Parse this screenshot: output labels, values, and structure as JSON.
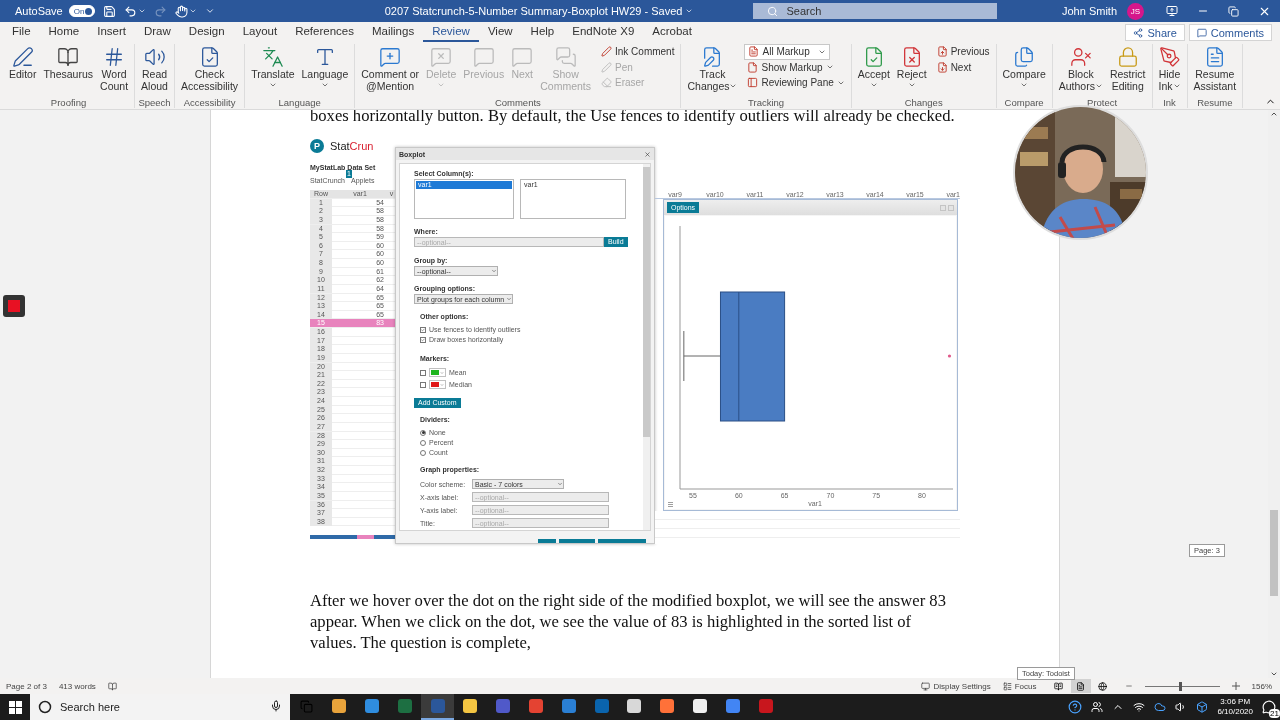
{
  "title_bar": {
    "autosave_label": "AutoSave",
    "autosave": {
      "label": "On",
      "on": true
    },
    "redo_disabled": true,
    "document_title": "0207 Statcrunch-5-Number Summary-Boxplot HW29  -  Saved",
    "search_placeholder": "Search",
    "user_name": "John Smith",
    "user_initials": "JS"
  },
  "ribbon_tabs": [
    {
      "label": "File",
      "selected": false
    },
    {
      "label": "Home",
      "selected": false
    },
    {
      "label": "Insert",
      "selected": false
    },
    {
      "label": "Draw",
      "selected": false
    },
    {
      "label": "Design",
      "selected": false
    },
    {
      "label": "Layout",
      "selected": false
    },
    {
      "label": "References",
      "selected": false
    },
    {
      "label": "Mailings",
      "selected": false
    },
    {
      "label": "Review",
      "selected": true
    },
    {
      "label": "View",
      "selected": false
    },
    {
      "label": "Help",
      "selected": false
    },
    {
      "label": "EndNote X9",
      "selected": false
    },
    {
      "label": "Acrobat",
      "selected": false
    }
  ],
  "share_button": "Share",
  "comments_button": "Comments",
  "ribbon_groups": [
    {
      "label": "Proofing",
      "buttons": [
        {
          "lines": [
            "Editor"
          ],
          "dropdown": false,
          "disabled": false
        },
        {
          "lines": [
            "Thesaurus"
          ],
          "dropdown": false,
          "disabled": false
        },
        {
          "lines": [
            "Word",
            "Count"
          ],
          "dropdown": false,
          "disabled": false
        }
      ]
    },
    {
      "label": "Speech",
      "buttons": [
        {
          "lines": [
            "Read",
            "Aloud"
          ],
          "dropdown": false,
          "disabled": false
        }
      ]
    },
    {
      "label": "Accessibility",
      "buttons": [
        {
          "lines": [
            "Check",
            "Accessibility"
          ],
          "dropdown": false,
          "disabled": false
        }
      ]
    },
    {
      "label": "Language",
      "buttons": [
        {
          "lines": [
            "Translate"
          ],
          "dropdown": true,
          "disabled": false
        },
        {
          "lines": [
            "Language"
          ],
          "dropdown": true,
          "disabled": false
        }
      ]
    },
    {
      "label": "Comments",
      "buttons": [
        {
          "lines": [
            "Comment or",
            "@Mention"
          ],
          "dropdown": false,
          "disabled": false
        },
        {
          "lines": [
            "Delete"
          ],
          "dropdown": true,
          "disabled": true
        },
        {
          "lines": [
            "Previous"
          ],
          "dropdown": false,
          "disabled": true
        },
        {
          "lines": [
            "Next"
          ],
          "dropdown": false,
          "disabled": true
        },
        {
          "lines": [
            "Show",
            "Comments"
          ],
          "dropdown": false,
          "disabled": true
        }
      ],
      "small_buttons": [
        {
          "kind": "button",
          "label": "Ink Comment",
          "dropdown": false,
          "disabled": false
        },
        {
          "kind": "button",
          "label": "Pen",
          "dropdown": false,
          "disabled": true
        },
        {
          "kind": "button",
          "label": "Eraser",
          "dropdown": false,
          "disabled": true
        }
      ]
    },
    {
      "label": "Tracking",
      "buttons": [
        {
          "lines": [
            "Track",
            "Changes"
          ],
          "dropdown": true,
          "disabled": false
        }
      ],
      "small_buttons": [
        {
          "kind": "select",
          "label": "All Markup",
          "dropdown": true,
          "disabled": false
        },
        {
          "kind": "button",
          "label": "Show Markup",
          "dropdown": true,
          "disabled": false
        },
        {
          "kind": "button",
          "label": "Reviewing Pane",
          "dropdown": true,
          "disabled": false
        }
      ]
    },
    {
      "label": "Changes",
      "buttons": [
        {
          "lines": [
            "Accept"
          ],
          "dropdown": true,
          "disabled": false
        },
        {
          "lines": [
            "Reject"
          ],
          "dropdown": true,
          "disabled": false
        }
      ],
      "small_buttons": [
        {
          "kind": "button",
          "label": "Previous",
          "dropdown": false,
          "disabled": false
        },
        {
          "kind": "button",
          "label": "Next",
          "dropdown": false,
          "disabled": false
        }
      ]
    },
    {
      "label": "Compare",
      "buttons": [
        {
          "lines": [
            "Compare"
          ],
          "dropdown": true,
          "disabled": false
        }
      ]
    },
    {
      "label": "Protect",
      "buttons": [
        {
          "lines": [
            "Block",
            "Authors"
          ],
          "dropdown": true,
          "disabled": false
        },
        {
          "lines": [
            "Restrict",
            "Editing"
          ],
          "dropdown": false,
          "disabled": false
        }
      ]
    },
    {
      "label": "Ink",
      "buttons": [
        {
          "lines": [
            "Hide",
            "Ink"
          ],
          "dropdown": true,
          "disabled": false
        }
      ]
    },
    {
      "label": "Resume",
      "buttons": [
        {
          "lines": [
            "Resume",
            "Assistant"
          ],
          "dropdown": false,
          "disabled": false
        }
      ]
    }
  ],
  "document": {
    "top_text": "boxes horizontally button. By default, the Use fences to identify outliers will already be checked.",
    "bottom_text": "After we hover over the dot on the right side of the modified boxplot, we will see the answer 83 appear. When we click on the dot, we see the value of 83 is highlighted in the sorted list of values. The question is complete,"
  },
  "statcrunch": {
    "logo_letter": "P",
    "logo_prefix": "Stat",
    "logo_suffix": "Crun",
    "dataset_title": "MyStatLab Data Set",
    "menu": [
      "StatCrunch",
      "Applets"
    ],
    "menu_badge": "1",
    "columns": [
      "Row",
      "var1",
      "v"
    ],
    "rows": [
      {
        "row": "1",
        "var1": "54",
        "selected": false
      },
      {
        "row": "2",
        "var1": "58",
        "selected": false
      },
      {
        "row": "3",
        "var1": "58",
        "selected": false
      },
      {
        "row": "4",
        "var1": "58",
        "selected": false
      },
      {
        "row": "5",
        "var1": "59",
        "selected": false
      },
      {
        "row": "6",
        "var1": "60",
        "selected": false
      },
      {
        "row": "7",
        "var1": "60",
        "selected": false
      },
      {
        "row": "8",
        "var1": "60",
        "selected": false
      },
      {
        "row": "9",
        "var1": "61",
        "selected": false
      },
      {
        "row": "10",
        "var1": "62",
        "selected": false
      },
      {
        "row": "11",
        "var1": "64",
        "selected": false
      },
      {
        "row": "12",
        "var1": "65",
        "selected": false
      },
      {
        "row": "13",
        "var1": "65",
        "selected": false
      },
      {
        "row": "14",
        "var1": "65",
        "selected": false
      },
      {
        "row": "15",
        "var1": "83",
        "selected": true
      },
      {
        "row": "16",
        "selected": false
      },
      {
        "row": "17",
        "selected": false
      },
      {
        "row": "18",
        "selected": false
      },
      {
        "row": "19",
        "selected": false
      },
      {
        "row": "20",
        "selected": false
      },
      {
        "row": "21",
        "selected": false
      },
      {
        "row": "22",
        "selected": false
      },
      {
        "row": "23",
        "selected": false
      },
      {
        "row": "24",
        "selected": false
      },
      {
        "row": "25",
        "selected": false
      },
      {
        "row": "26",
        "selected": false
      },
      {
        "row": "27",
        "selected": false
      },
      {
        "row": "28",
        "selected": false
      },
      {
        "row": "29",
        "selected": false
      },
      {
        "row": "30",
        "selected": false
      },
      {
        "row": "31",
        "selected": false
      },
      {
        "row": "32",
        "selected": false
      },
      {
        "row": "33",
        "selected": false
      },
      {
        "row": "34",
        "selected": false
      },
      {
        "row": "35",
        "selected": false
      },
      {
        "row": "36",
        "selected": false
      },
      {
        "row": "37",
        "selected": false
      },
      {
        "row": "38",
        "selected": false
      }
    ]
  },
  "boxplot_dialog": {
    "title": "Boxplot",
    "select_label": "Select Column(s):",
    "source_columns": [
      {
        "label": "var1",
        "selected": true
      }
    ],
    "selected_columns": [
      "var1"
    ],
    "where_label": "Where:",
    "where_placeholder": "--optional--",
    "build_button": "Build",
    "group_by_label": "Group by:",
    "group_by_value": "--optional--",
    "grouping_label": "Grouping options:",
    "grouping_value": "Plot groups for each column",
    "other_label": "Other options:",
    "options": [
      {
        "label": "Use fences to identify outliers",
        "checked": true
      },
      {
        "label": "Draw boxes horizontally",
        "checked": true
      }
    ],
    "markers_label": "Markers:",
    "markers": [
      {
        "label": "Mean",
        "checked": false,
        "color": "#1fb51f"
      },
      {
        "label": "Median",
        "checked": false,
        "color": "#e01818"
      }
    ],
    "add_custom_button": "Add Custom",
    "dividers_label": "Dividers:",
    "dividers": [
      {
        "label": "None",
        "selected": true
      },
      {
        "label": "Percent",
        "selected": false
      },
      {
        "label": "Count",
        "selected": false
      }
    ],
    "graph_label": "Graph properties:",
    "graph_fields": [
      {
        "kind": "select",
        "label": "Color scheme:",
        "value": "Basic - 7 colors"
      },
      {
        "kind": "input",
        "label": "X-axis label:",
        "placeholder": "--optional--"
      },
      {
        "kind": "input",
        "label": "Y-axis label:",
        "placeholder": "--optional--"
      },
      {
        "kind": "input",
        "label": "Title:",
        "placeholder": "--optional--"
      }
    ]
  },
  "chart_window": {
    "column_headers": [
      "var9",
      "var10",
      "var11",
      "var12",
      "var13",
      "var14",
      "var15",
      "var1"
    ],
    "options_button": "Options",
    "x_ticks": [
      "55",
      "60",
      "65",
      "70",
      "75",
      "80"
    ],
    "x_label": "var1"
  },
  "page_tooltip": "Page: 3",
  "status_bar": {
    "page": "Page 2 of 3",
    "words": "413 words",
    "tooltip": "Today: Todoist",
    "display_settings": "Display Settings",
    "focus": "Focus",
    "views": [
      {
        "selected": false
      },
      {
        "selected": true
      },
      {
        "selected": false
      }
    ],
    "zoom_slider": {
      "level": 0.47
    },
    "zoom": "156%"
  },
  "taskbar": {
    "search_placeholder": "Search here",
    "apps": [
      {
        "color": "#e8a33b",
        "selected": false
      },
      {
        "color": "#2f8ddf",
        "selected": false
      },
      {
        "color": "#1d6f42",
        "selected": false
      },
      {
        "color": "#2b579a",
        "selected": true
      },
      {
        "color": "#f4c542",
        "selected": false
      },
      {
        "color": "#5059c9",
        "selected": false
      },
      {
        "color": "#e44332",
        "selected": false
      },
      {
        "color": "#2a7fd4",
        "selected": false
      },
      {
        "color": "#0a64ad",
        "selected": false
      },
      {
        "color": "#d8d8d8",
        "selected": false
      },
      {
        "color": "#ff7139",
        "selected": false
      },
      {
        "color": "#f0f0f0",
        "selected": false
      },
      {
        "color": "#4285f4",
        "selected": false
      },
      {
        "color": "#c8161d",
        "selected": false
      }
    ],
    "time": "3:06 PM",
    "date": "6/10/2020",
    "notifications": "21"
  }
}
